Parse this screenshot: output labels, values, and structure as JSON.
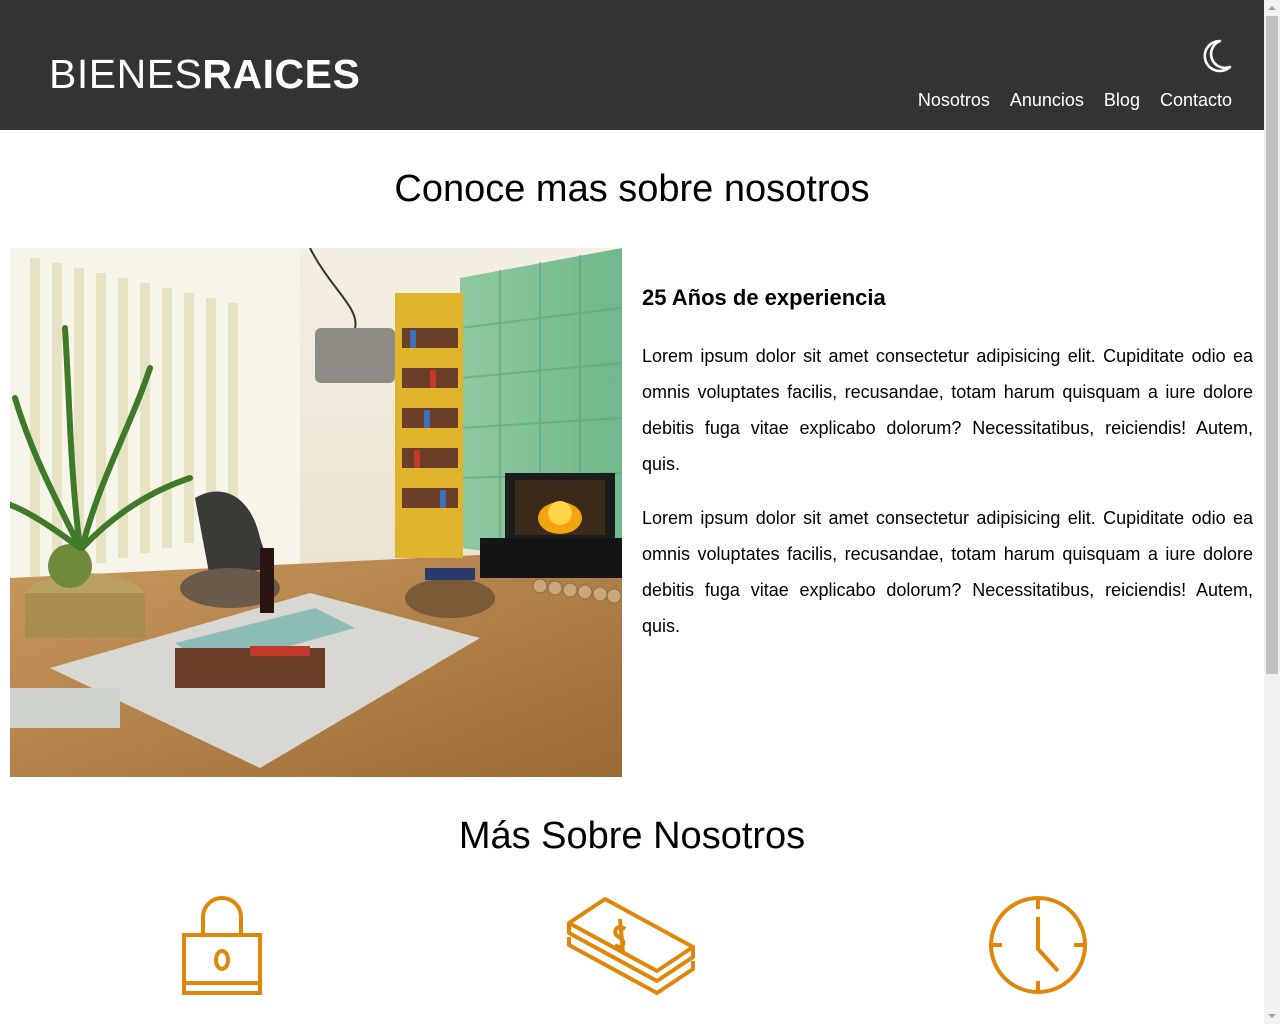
{
  "header": {
    "logo_light": "BIENES",
    "logo_bold": "RAICES",
    "dark_mode_icon": "moon-icon",
    "nav": [
      {
        "label": "Nosotros"
      },
      {
        "label": "Anuncios"
      },
      {
        "label": "Blog"
      },
      {
        "label": "Contacto"
      }
    ]
  },
  "about": {
    "title": "Conoce mas sobre nosotros",
    "image_alt": "living-room-photo",
    "subtitle": "25 Años de experiencia",
    "paragraphs": [
      "Lorem ipsum dolor sit amet consectetur adipisicing elit. Cupiditate odio ea omnis voluptates facilis, recusandae, totam harum quisquam a iure dolore debitis fuga vitae explicabo dolorum? Necessitatibus, reiciendis! Autem, quis.",
      "Lorem ipsum dolor sit amet consectetur adipisicing elit. Cupiditate odio ea omnis voluptates facilis, recusandae, totam harum quisquam a iure dolore debitis fuga vitae explicabo dolorum? Necessitatibus, reiciendis! Autem, quis."
    ]
  },
  "more": {
    "title": "Más Sobre Nosotros",
    "icons": [
      "lock-icon",
      "money-icon",
      "clock-icon"
    ],
    "accent_color": "#e08709"
  },
  "colors": {
    "header_bg": "#333333",
    "header_text": "#ffffff",
    "accent": "#e08709"
  }
}
